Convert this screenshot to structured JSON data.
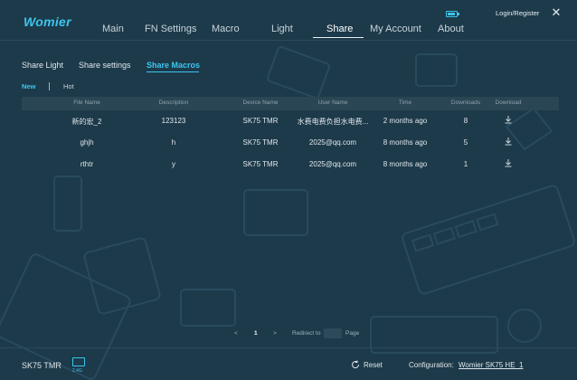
{
  "app": {
    "logo": "Womier",
    "login": "Login/Register",
    "close": "✕"
  },
  "nav": {
    "items": [
      "Main",
      "FN Settings",
      "Macro",
      "Light",
      "Share",
      "My Account",
      "About"
    ],
    "active": "Share"
  },
  "subtabs": {
    "items": [
      "Share Light",
      "Share settings",
      "Share Macros"
    ],
    "active": "Share Macros"
  },
  "filters": {
    "items": [
      "New",
      "Hot"
    ],
    "active": "New"
  },
  "table": {
    "headers": [
      "File Name",
      "Description",
      "Device Name",
      "User Name",
      "Time",
      "Downloads",
      "Download"
    ],
    "rows": [
      [
        "新的宏_2",
        "123123",
        "SK75 TMR",
        "水费电费负担水电费...",
        "2 months ago",
        "8"
      ],
      [
        "ghjh",
        "h",
        "SK75 TMR",
        "2025@qq.com",
        "8 months ago",
        "5"
      ],
      [
        "rthtr",
        "y",
        "SK75 TMR",
        "2025@qq.com",
        "8 months ago",
        "1"
      ]
    ]
  },
  "pagination": {
    "prev": "<",
    "page": "1",
    "next": ">",
    "redirect_label": "Redirect to",
    "page_label": "Page",
    "input_value": ""
  },
  "footer": {
    "device": "SK75 TMR",
    "wireless": "2.4G",
    "reset": "Reset",
    "config_label": "Configuration:",
    "config_value": "Womier SK75 HE_1"
  },
  "colors": {
    "background": "#1d3a4a",
    "accent": "#3cc5ee",
    "header_row": "#2a4554"
  }
}
